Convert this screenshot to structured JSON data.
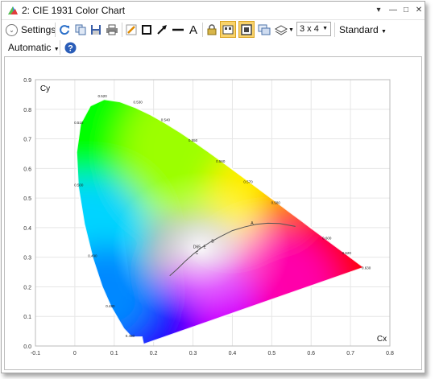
{
  "window": {
    "title": "2: CIE 1931 Color Chart",
    "buttons": {
      "collapse": "▾",
      "minimize": "—",
      "maximize": "□",
      "close": "✕"
    }
  },
  "toolbar": {
    "settings_label": "Settings",
    "grid_combo_value": "3 x 4",
    "style_dropdown": "Standard",
    "scale_dropdown": "Automatic",
    "icons": [
      "refresh-icon",
      "copy-icon",
      "save-icon",
      "print-icon",
      "pencil-icon",
      "rectangle-icon",
      "arrow-icon",
      "line-icon",
      "text-icon",
      "lock-icon",
      "layout-icon",
      "fit-icon",
      "export-icon",
      "layers-icon",
      "help-icon"
    ],
    "accent_toggle_color": "#f9d36b"
  },
  "chart_data": {
    "type": "scatter",
    "xlabel": "Cx",
    "ylabel": "Cy",
    "xlim": [
      -0.1,
      0.8
    ],
    "ylim": [
      0.0,
      0.9
    ],
    "x_ticks": [
      "-0.1",
      "0",
      "0.1",
      "0.2",
      "0.3",
      "0.4",
      "0.5",
      "0.6",
      "0.7",
      "0.8"
    ],
    "y_ticks": [
      "0.0",
      "0.1",
      "0.2",
      "0.3",
      "0.4",
      "0.5",
      "0.6",
      "0.7",
      "0.8",
      "0.9"
    ],
    "wavelength_labels": [
      {
        "label": "0.460",
        "x": 0.14,
        "y": 0.03
      },
      {
        "label": "0.480",
        "x": 0.09,
        "y": 0.13
      },
      {
        "label": "0.490",
        "x": 0.045,
        "y": 0.3
      },
      {
        "label": "0.500",
        "x": 0.01,
        "y": 0.54
      },
      {
        "label": "0.510",
        "x": 0.01,
        "y": 0.75
      },
      {
        "label": "0.520",
        "x": 0.07,
        "y": 0.84
      },
      {
        "label": "0.530",
        "x": 0.16,
        "y": 0.82
      },
      {
        "label": "0.540",
        "x": 0.23,
        "y": 0.76
      },
      {
        "label": "0.550",
        "x": 0.3,
        "y": 0.69
      },
      {
        "label": "0.560",
        "x": 0.37,
        "y": 0.62
      },
      {
        "label": "0.570",
        "x": 0.44,
        "y": 0.55
      },
      {
        "label": "0.580",
        "x": 0.51,
        "y": 0.48
      },
      {
        "label": "0.600",
        "x": 0.64,
        "y": 0.36
      },
      {
        "label": "0.620",
        "x": 0.69,
        "y": 0.31
      },
      {
        "label": "0.630",
        "x": 0.74,
        "y": 0.26
      }
    ],
    "illuminant_labels": [
      {
        "label": "D65",
        "x": 0.31,
        "y": 0.33
      },
      {
        "label": "B",
        "x": 0.35,
        "y": 0.35
      },
      {
        "label": "A",
        "x": 0.45,
        "y": 0.41
      },
      {
        "label": "C",
        "x": 0.31,
        "y": 0.31
      },
      {
        "label": "E",
        "x": 0.33,
        "y": 0.33
      }
    ],
    "spectral_locus": [
      [
        0.1741,
        0.005
      ],
      [
        0.17,
        0.03
      ],
      [
        0.144,
        0.0297
      ],
      [
        0.1241,
        0.0578
      ],
      [
        0.0913,
        0.1327
      ],
      [
        0.0687,
        0.2007
      ],
      [
        0.0454,
        0.295
      ],
      [
        0.0235,
        0.4127
      ],
      [
        0.0082,
        0.5384
      ],
      [
        0.0039,
        0.6548
      ],
      [
        0.0139,
        0.7502
      ],
      [
        0.0389,
        0.812
      ],
      [
        0.0743,
        0.8338
      ],
      [
        0.1142,
        0.8262
      ],
      [
        0.1547,
        0.8059
      ],
      [
        0.1929,
        0.7816
      ],
      [
        0.2296,
        0.7543
      ],
      [
        0.2658,
        0.7243
      ],
      [
        0.3016,
        0.6923
      ],
      [
        0.3373,
        0.6589
      ],
      [
        0.3731,
        0.6245
      ],
      [
        0.4087,
        0.5896
      ],
      [
        0.4441,
        0.5547
      ],
      [
        0.4788,
        0.5202
      ],
      [
        0.5125,
        0.4866
      ],
      [
        0.5448,
        0.4544
      ],
      [
        0.5752,
        0.4242
      ],
      [
        0.6029,
        0.3965
      ],
      [
        0.627,
        0.3725
      ],
      [
        0.6482,
        0.3514
      ],
      [
        0.6658,
        0.334
      ],
      [
        0.6915,
        0.3083
      ],
      [
        0.7079,
        0.292
      ],
      [
        0.7347,
        0.2653
      ]
    ],
    "planckian_locus": [
      [
        0.241,
        0.237
      ],
      [
        0.26,
        0.26
      ],
      [
        0.28,
        0.286
      ],
      [
        0.3,
        0.31
      ],
      [
        0.32,
        0.331
      ],
      [
        0.345,
        0.352
      ],
      [
        0.37,
        0.37
      ],
      [
        0.4,
        0.39
      ],
      [
        0.43,
        0.402
      ],
      [
        0.46,
        0.411
      ],
      [
        0.49,
        0.415
      ],
      [
        0.52,
        0.414
      ],
      [
        0.56,
        0.404
      ]
    ],
    "grid": true,
    "legend": "none"
  }
}
